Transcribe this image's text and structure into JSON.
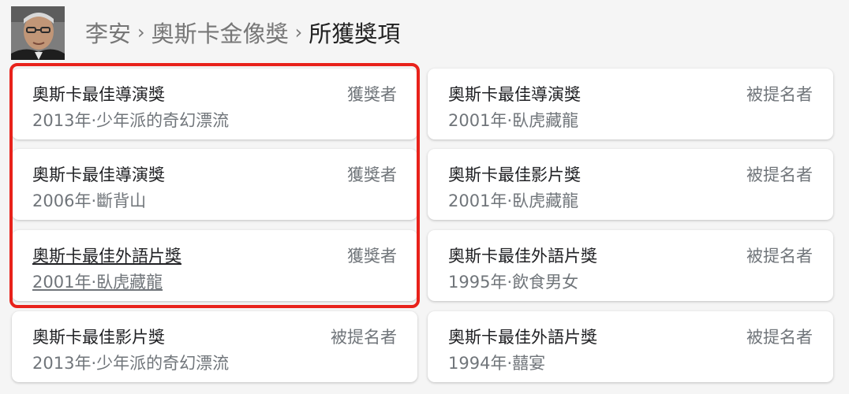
{
  "colors": {
    "background": "#f5f5f5",
    "card": "#ffffff",
    "primary_text": "#202124",
    "secondary_text": "#70757a",
    "highlight": "#e8221b"
  },
  "header": {
    "avatar_icon": "person-photo-icon",
    "breadcrumb": [
      {
        "label": "李安"
      },
      {
        "label": "奧斯卡金像獎"
      },
      {
        "label": "所獲獎項"
      }
    ],
    "separator_icon": "chevron-right-icon"
  },
  "awards": [
    {
      "title": "奧斯卡最佳導演獎",
      "detail": "2013年·少年派的奇幻漂流",
      "status": "獲獎者"
    },
    {
      "title": "奧斯卡最佳導演獎",
      "detail": "2001年·臥虎藏龍",
      "status": "被提名者"
    },
    {
      "title": "奧斯卡最佳導演獎",
      "detail": "2006年·斷背山",
      "status": "獲獎者"
    },
    {
      "title": "奧斯卡最佳影片獎",
      "detail": "2001年·臥虎藏龍",
      "status": "被提名者"
    },
    {
      "title": "奧斯卡最佳外語片獎",
      "detail": "2001年·臥虎藏龍",
      "status": "獲獎者"
    },
    {
      "title": "奧斯卡最佳外語片獎",
      "detail": "1995年·飲食男女",
      "status": "被提名者"
    },
    {
      "title": "奧斯卡最佳影片獎",
      "detail": "2013年·少年派的奇幻漂流",
      "status": "被提名者"
    },
    {
      "title": "奧斯卡最佳外語片獎",
      "detail": "1994年·囍宴",
      "status": "被提名者"
    }
  ]
}
